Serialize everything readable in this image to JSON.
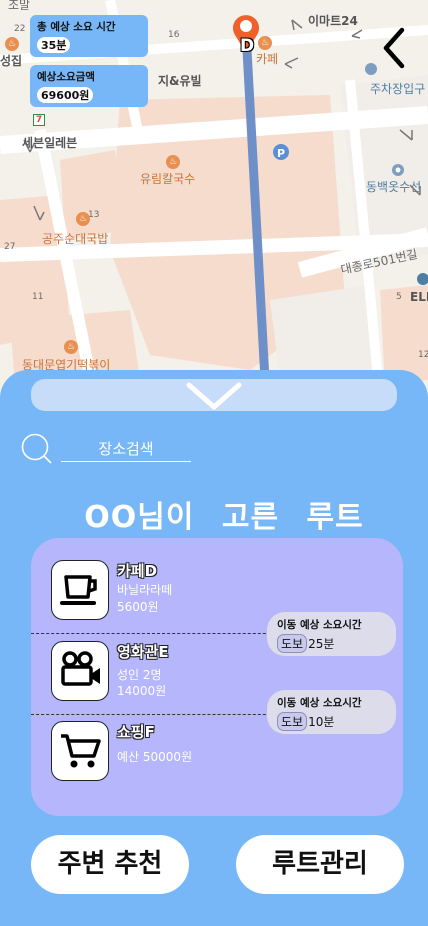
{
  "map": {
    "labels": {
      "top_left_store": "조말",
      "emart24": "이마트24",
      "seongjip": "성집",
      "cafe": "카페",
      "jiyubil": "지&유빌",
      "parking": "주차장입구",
      "seven_eleven": "세븐일레븐",
      "kalguksu": "유림칼국수",
      "dongbaek": "동백옷수선",
      "gukbap": "공주순대국밥",
      "road": "대종로501번길",
      "tteokbokki": "동대문엽기떡볶이",
      "ell": "ELL"
    },
    "numbers": [
      "22",
      "16",
      "13",
      "27",
      "11",
      "5",
      "12"
    ]
  },
  "summary": {
    "time_title": "총 예상 소요 시간",
    "time_value": "35분",
    "cost_title": "예상소요금액",
    "cost_value": "69600원"
  },
  "pin": {
    "label": "D"
  },
  "search": {
    "placeholder": "장소검색"
  },
  "route": {
    "title": "OO님이 고른 루트",
    "places": [
      {
        "name": "카페D",
        "details": [
          "바닐라라떼",
          "5600원"
        ],
        "icon": "coffee-cup-icon"
      },
      {
        "name": "영화관E",
        "details": [
          "성인 2명",
          "14000원"
        ],
        "icon": "movie-camera-icon"
      },
      {
        "name": "쇼핑F",
        "details": [
          "예산 50000원"
        ],
        "icon": "shopping-cart-icon"
      }
    ],
    "travels": [
      {
        "title": "이동 예상 소요시간",
        "mode": "도보",
        "duration": "25분"
      },
      {
        "title": "이동 예상 소요시간",
        "mode": "도보",
        "duration": "10분"
      }
    ]
  },
  "buttons": {
    "nearby": "주변 추천",
    "manage": "루트관리"
  },
  "colors": {
    "sheet": "#77b7f7",
    "card": "#b5b6fc",
    "route_line": "#6f8fc9",
    "pin": "#f0602b"
  }
}
